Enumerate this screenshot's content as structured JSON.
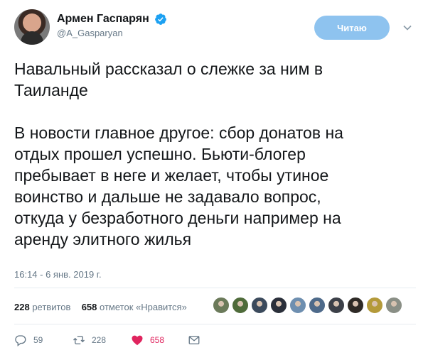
{
  "author": {
    "display_name": "Армен Гаспарян",
    "handle": "@A_Gasparyan",
    "verified_icon": "verified-badge-icon"
  },
  "follow_button": {
    "label": "Читаю"
  },
  "tweet": {
    "text": "Навальный рассказал о слежке за ним в\nТаиланде\n\nВ новости главное другое: сбор донатов на\nотдых прошел успешно. Бьюти-блогер\nпребывает в неге и желает, чтобы утиное\nвоинство и дальше не задавало вопрос,\nоткуда у безработного деньги например на\nаренду элитного жилья",
    "timestamp": "16:14 - 6 янв. 2019 г."
  },
  "stats": {
    "retweets_count": "228",
    "retweets_label": "ретвитов",
    "likes_count": "658",
    "likes_label": "отметок «Нравится»",
    "liker_avatars": [
      "#6b7a5a",
      "#4f6b3a",
      "#3b4a5c",
      "#2a2f3a",
      "#6e8fb0",
      "#4e6a8a",
      "#3c4048",
      "#2e2a26",
      "#b49a3a",
      "#8a8f86"
    ]
  },
  "actions": {
    "reply_count": "59",
    "retweet_count": "228",
    "like_count": "658"
  },
  "colors": {
    "accent": "#8ec3ef",
    "like": "#e0245e",
    "verified": "#1da1f2"
  }
}
